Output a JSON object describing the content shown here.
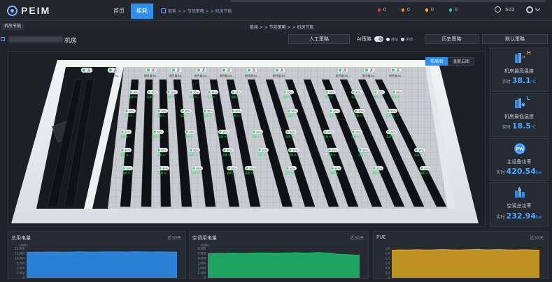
{
  "app": {
    "logo_text": "PEIM"
  },
  "nav": {
    "home": "首页",
    "energy": "能耗",
    "crumb": "能耗 > > 节能策略 > > 机房节能"
  },
  "alerts": [
    {
      "count": "0",
      "color": "#e53935"
    },
    {
      "count": "0",
      "color": "#fb8c00"
    },
    {
      "count": "0",
      "color": "#f9b016"
    },
    {
      "count": "0",
      "color": "#1ec7e6"
    }
  ],
  "user": {
    "name": "502"
  },
  "tabs": {
    "active_tab": "机房节能",
    "page_crumb": "能耗 > > 节能策略 > > 机房节能"
  },
  "room": {
    "title_suffix": "机房"
  },
  "strategy": {
    "manual": "人工策略",
    "ai_label": "AI策略",
    "auto": "自动",
    "manual_mode": "手动",
    "history": "历史策略",
    "default": "默认策略"
  },
  "view": {
    "layout": "布局图",
    "cloud": "温度云图"
  },
  "racks": {
    "status_top": "开",
    "unit_label": "制冷量(N)...",
    "tag_label": "温度 N...",
    "tag_percent": "36%"
  },
  "stats": {
    "max_temp": {
      "label": "机房最高温度",
      "prefix": "实时",
      "value": "38.1",
      "unit": "°C",
      "letter": "H"
    },
    "min_temp": {
      "label": "机房最低温度",
      "prefix": "实时",
      "value": "18.5",
      "unit": "°C",
      "letter": "L"
    },
    "main_power": {
      "label": "主设备功率",
      "prefix": "实时",
      "value": "420.54",
      "unit": "kw",
      "letter": "PW"
    },
    "ac_power": {
      "label": "空调总功率",
      "prefix": "实时",
      "value": "232.94",
      "unit": "kw"
    }
  },
  "chart_data": [
    {
      "type": "area",
      "title": "总用电量",
      "range_label": "近30天",
      "ylabel": "(kWh)",
      "y_ticks": [
        "12,000",
        "11,000",
        "10,000",
        "8,000",
        "4,000",
        "2,000",
        "0"
      ],
      "ylim": [
        0,
        12000
      ],
      "values": [
        10400,
        10450,
        10500,
        10480,
        10520,
        10550,
        10500,
        10480,
        10520,
        10560,
        10600,
        10580,
        10550,
        10520,
        10560,
        10580,
        10600,
        10620,
        10580,
        10560,
        10600,
        10640,
        10600,
        10580,
        10560,
        10600,
        10580,
        10550,
        10520,
        10480
      ],
      "color": "#2b8ff0"
    },
    {
      "type": "area",
      "title": "空调用电量",
      "range_label": "近30天",
      "ylabel": "(kWh)",
      "y_ticks": [
        "6,000",
        "5,000",
        "4,000",
        "3,000",
        "2,000",
        "1,000",
        "0"
      ],
      "ylim": [
        0,
        6000
      ],
      "values": [
        4900,
        4950,
        5000,
        4980,
        5020,
        5050,
        5000,
        4980,
        5020,
        5060,
        5100,
        5080,
        5050,
        5020,
        5060,
        5080,
        5100,
        5120,
        5080,
        5060,
        5100,
        5140,
        5100,
        5060,
        4900,
        4800,
        4750,
        4700,
        4650,
        4600
      ],
      "color": "#1fb86a"
    },
    {
      "type": "area",
      "title": "PUE",
      "range_label": "近30天",
      "ylabel": "",
      "y_ticks": [
        "1.6",
        "1.4",
        "1.2",
        "1.0",
        "0.8",
        "0.4",
        "0"
      ],
      "ylim": [
        0,
        1.6
      ],
      "values": [
        1.5,
        1.51,
        1.52,
        1.51,
        1.52,
        1.53,
        1.52,
        1.51,
        1.52,
        1.53,
        1.54,
        1.53,
        1.52,
        1.51,
        1.52,
        1.53,
        1.54,
        1.55,
        1.53,
        1.52,
        1.53,
        1.54,
        1.53,
        1.52,
        1.51,
        1.52,
        1.53,
        1.52,
        1.51,
        1.5
      ],
      "color": "#d9a420"
    }
  ]
}
